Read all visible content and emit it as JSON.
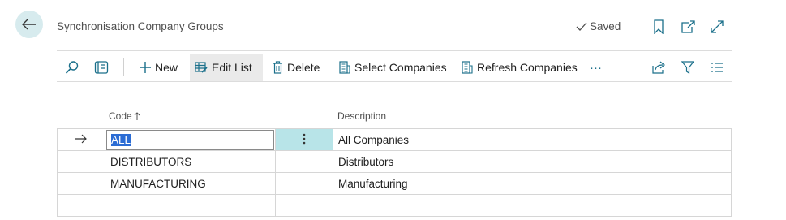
{
  "header": {
    "title": "Synchronisation Company Groups",
    "saved_label": "Saved"
  },
  "toolbar": {
    "new_label": "New",
    "edit_list_label": "Edit List",
    "delete_label": "Delete",
    "select_companies_label": "Select Companies",
    "refresh_companies_label": "Refresh Companies",
    "more_label": "···"
  },
  "list": {
    "columns": {
      "code": "Code",
      "description": "Description"
    },
    "rows": [
      {
        "code": "ALL",
        "description": "All Companies"
      },
      {
        "code": "DISTRIBUTORS",
        "description": "Distributors"
      },
      {
        "code": "MANUFACTURING",
        "description": "Manufacturing"
      }
    ]
  },
  "colors": {
    "accent": "#d7ebee",
    "selection": "#2b6cd4",
    "active_cell": "#b8e4e8"
  }
}
